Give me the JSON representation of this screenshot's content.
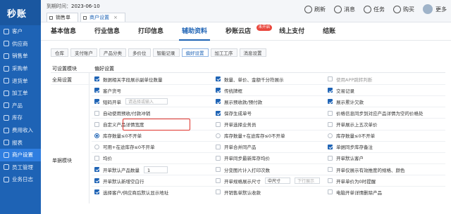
{
  "sidebar": {
    "logo": "秒账",
    "items": [
      {
        "label": "客户",
        "icon": "person-icon"
      },
      {
        "label": "供应商",
        "icon": "truck-icon"
      },
      {
        "label": "销售单",
        "icon": "cart-icon"
      },
      {
        "label": "采购单",
        "icon": "box-icon"
      },
      {
        "label": "退货单",
        "icon": "return-icon"
      },
      {
        "label": "加工单",
        "icon": "tool-icon"
      },
      {
        "label": "产品",
        "icon": "cube-icon"
      },
      {
        "label": "库存",
        "icon": "warehouse-icon"
      },
      {
        "label": "费用收入",
        "icon": "money-icon"
      },
      {
        "label": "报表",
        "icon": "chart-icon"
      },
      {
        "label": "商户设置",
        "icon": "gear-icon",
        "active": true
      },
      {
        "label": "员工管理",
        "icon": "users-icon"
      },
      {
        "label": "业务日志",
        "icon": "log-icon"
      }
    ]
  },
  "topbar": {
    "expire_label": "到期时间：",
    "expire_date": "2023-06-10",
    "tabs": [
      {
        "label": "销售单"
      },
      {
        "label": "商户设置",
        "active": true
      }
    ],
    "actions": {
      "refresh": "刷新",
      "message": "消息",
      "task": "任务",
      "buy": "购买",
      "more": "更多"
    }
  },
  "main_tabs": [
    "基本信息",
    "行业信息",
    "打印信息",
    "辅助资料",
    "秒账云店",
    "线上支付",
    "结账"
  ],
  "main_tab_active": "辅助资料",
  "cloud_badge": "未开启",
  "sub_tabs": [
    "仓库",
    "支付账户",
    "产品分类",
    "多价位",
    "智能记录",
    "偏好设置",
    "加工工序",
    "消息设置"
  ],
  "sub_tab_active": "偏好设置",
  "header": {
    "module": "可设置模块",
    "pref": "偏好设置"
  },
  "modules": {
    "global": "全局设置",
    "doc": "单据模块"
  },
  "rows": [
    {
      "c1": {
        "on": true,
        "text": "数据相关字段展示副单位数量"
      },
      "c2": {
        "on": true,
        "text": "数量、单价、金额千分符展示"
      },
      "c3": {
        "on": false,
        "text": "使用APP跳转判断",
        "disabled": true
      }
    },
    {
      "c1": {
        "on": true,
        "text": "客户货号"
      },
      "c2": {
        "on": true,
        "text": "传统牌框"
      },
      "c3": {
        "on": true,
        "text": "交易记录"
      }
    },
    {
      "c1": {
        "on": true,
        "text": "短码开单",
        "select": "请选择或输入"
      },
      "c2": {
        "on": true,
        "text": "展示预收款/预付款"
      },
      "c3": {
        "on": true,
        "text": "展示累计欠款"
      }
    },
    {
      "c1": {
        "on": false,
        "text": "自动使用预收/付款冲销"
      },
      "c2": {
        "on": true,
        "text": "保存生成单号"
      },
      "c3": {
        "on": false,
        "text": "价格信息同步到对应产品详情为空的价格处"
      }
    },
    {
      "c1": {
        "on": false,
        "text": "自定义产品详情宽度"
      },
      "c2": {
        "on": false,
        "text": "开单选择业务员"
      },
      "c3": {
        "on": false,
        "text": "开单展示上五次单价"
      }
    },
    {
      "c1": {
        "radio": true,
        "on": true,
        "text": "库存数量≤0不开单"
      },
      "c2": {
        "radio": true,
        "on": false,
        "text": "库存数量+在途库存≤0不开单"
      },
      "c3": {
        "radio": true,
        "on": false,
        "text": "库存数量≤0不开单"
      }
    },
    {
      "c1": {
        "radio": true,
        "on": false,
        "text": "可用+在途库存≤0不开单"
      },
      "c2": {
        "on": false,
        "text": "开单合并同产品"
      },
      "c3": {
        "on": true,
        "text": "单据同步库存备注"
      }
    },
    {
      "c1": {
        "on": false,
        "text": "均价"
      },
      "c2": {
        "on": false,
        "text": "开单同步最新库存均价"
      },
      "c3": {
        "on": false,
        "text": "开单默认客户"
      }
    },
    {
      "c1": {
        "on": true,
        "text": "开单默认产品数量",
        "number": "1"
      },
      "c2": {
        "on": false,
        "text": "分变图片计入打印次数"
      },
      "c3": {
        "on": false,
        "text": "开单仅展示有效推度的规格、颜色"
      }
    },
    {
      "c1": {
        "on": true,
        "text": "开单默认新增空白行"
      },
      "c2": {
        "on": false,
        "text": "开单规格展示尺寸",
        "select": "中尺寸",
        "select2": "下行展示"
      },
      "c3": {
        "on": false,
        "text": "开单单价为0时提醒"
      }
    },
    {
      "c1": {
        "on": true,
        "text": "选择客户/供应商后默认显示地址"
      },
      "c2": {
        "on": false,
        "text": "开销售单默认收款"
      },
      "c3": {
        "on": false,
        "text": "电脑开单详情删除产品"
      }
    }
  ]
}
